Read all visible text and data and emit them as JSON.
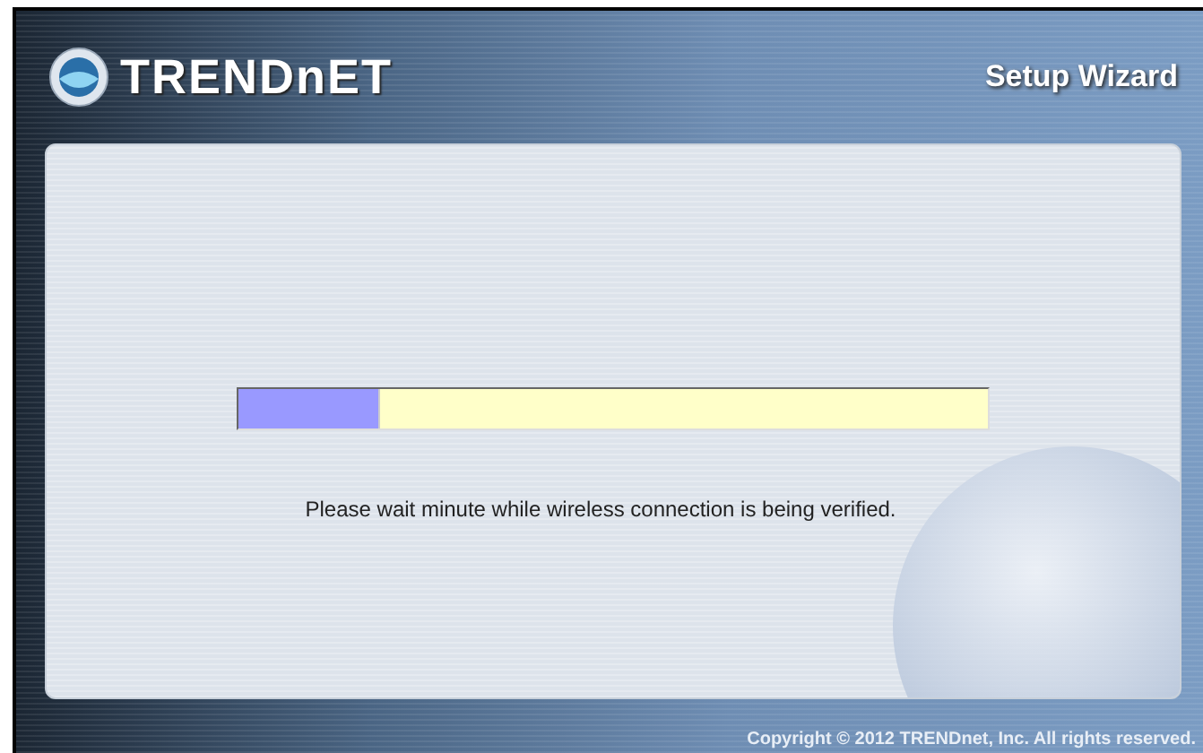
{
  "header": {
    "logo": "TRENDnET",
    "title": "Setup Wizard"
  },
  "progress": {
    "level": 0.186
  },
  "message": "Please wait minute while wireless connection is being verified.",
  "footer": {
    "copyright": "Copyright © 2012 TRENDnet, Inc. All rights reserved."
  }
}
